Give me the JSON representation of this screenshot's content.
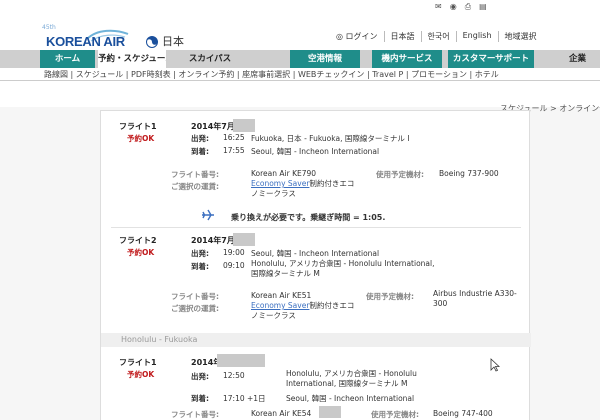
{
  "header": {
    "anniversary": "45th",
    "brand": "KOREAN AIR",
    "region": "日本",
    "util_links": [
      "ログイン",
      "日本語",
      "한국어",
      "English",
      "地域選択"
    ]
  },
  "nav": {
    "home": "ホーム",
    "tabs": [
      "予約・スケジュール",
      "スカイパス",
      "空港情報",
      "機内サービス",
      "カスタマーサポート",
      "企業"
    ]
  },
  "subnav": {
    "items": [
      "路線図",
      "スケジュール",
      "PDF時刻表",
      "オンライン予約",
      "座席事前選択",
      "WEBチェックイン",
      "Travel P",
      "プロモーション",
      "ホテル"
    ]
  },
  "breadcrumb": "スケジュール > オンライン予約",
  "itinerary": {
    "outbound": [
      {
        "label": "フライト1",
        "status": "予約OK",
        "date": "2014年7月",
        "depart_label": "出発:",
        "depart_time": "16:25",
        "depart_place": "Fukuoka, 日本 - Fukuoka, 国際線ターミナル I",
        "arrive_label": "到着:",
        "arrive_time": "17:55",
        "arrive_place": "Seoul, 韓国 - Incheon International",
        "flight_no_label": "フライト番号:",
        "flight_no": "Korean Air KE790",
        "aircraft_label": "使用予定機材:",
        "aircraft": "Boeing 737-900",
        "fare_label": "ご選択の運賃:",
        "fare_link": "Economy Saver",
        "fare_rest": "制約付きエコノミークラス"
      },
      {
        "label": "フライト2",
        "status": "予約OK",
        "date": "2014年7月",
        "depart_label": "出発:",
        "depart_time": "19:00",
        "depart_place": "Seoul, 韓国 - Incheon International",
        "arrive_label": "到着:",
        "arrive_time": "09:10",
        "arrive_place": "Honolulu, アメリカ合衆国 - Honolulu International, 国際線ターミナル M",
        "flight_no_label": "フライト番号:",
        "flight_no": "Korean Air KE51",
        "aircraft_label": "使用予定機材:",
        "aircraft": "Airbus Industrie A330-300",
        "fare_label": "ご選択の運賃:",
        "fare_link": "Economy Saver",
        "fare_rest": "制約付きエコノミークラス"
      }
    ],
    "transfer_note": "乗り換えが必要です。乗継ぎ時間 = 1:05.",
    "return_section": "Honolulu - Fukuoka",
    "return": [
      {
        "label": "フライト1",
        "status": "予約OK",
        "date": "2014年",
        "depart_label": "出発:",
        "depart_time": "12:50",
        "depart_place": "Honolulu, アメリカ合衆国 - Honolulu International, 国際線ターミナル M",
        "arrive_label": "到着:",
        "arrive_time": "17:10 +1日",
        "arrive_place": "Seoul, 韓国 - Incheon International",
        "flight_no_label": "フライト番号:",
        "flight_no": "Korean Air KE54",
        "aircraft_label": "使用予定機材:",
        "aircraft": "Boeing 747-400"
      }
    ]
  },
  "colors": {
    "brand_blue": "#1a4f9c",
    "nav_teal": "#1f8d8a",
    "status_red": "#c0181a",
    "link_blue": "#3b6fc0"
  }
}
